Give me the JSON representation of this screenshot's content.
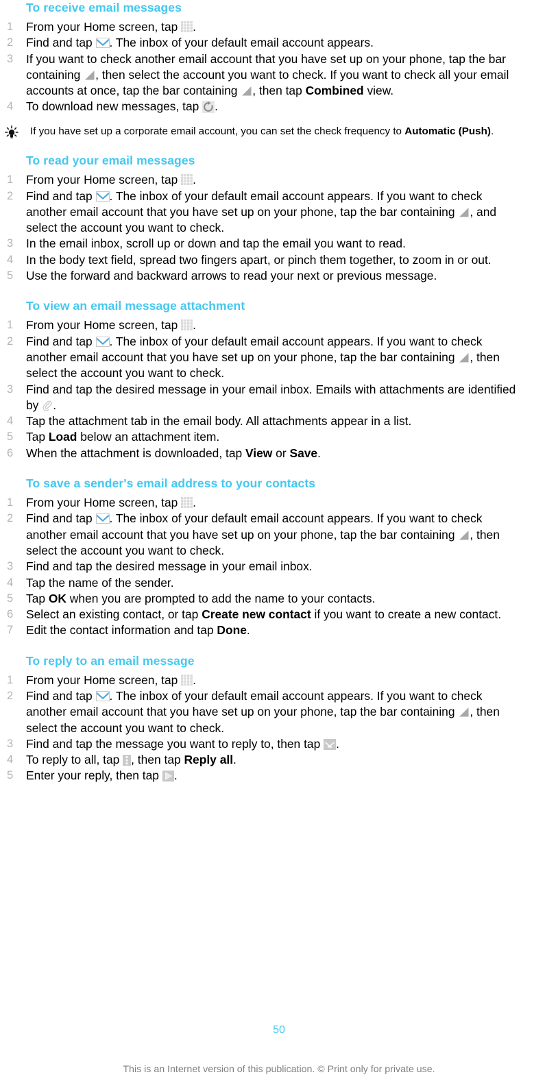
{
  "document": {
    "page_number": "50",
    "disclaimer": "This is an Internet version of this publication. © Print only for private use.",
    "accent_color": "#44c8f0",
    "text_color": "#000000",
    "number_color": "#b4b4b4",
    "footer_color": "#808080"
  },
  "sections": [
    {
      "heading": "To receive email messages",
      "steps": [
        {
          "number": "1",
          "parts": [
            {
              "t": "text",
              "v": "From your Home screen, tap "
            },
            {
              "t": "icon",
              "v": "grid-icon"
            },
            {
              "t": "text",
              "v": "."
            }
          ]
        },
        {
          "number": "2",
          "parts": [
            {
              "t": "text",
              "v": "Find and tap "
            },
            {
              "t": "icon",
              "v": "envelope-icon"
            },
            {
              "t": "text",
              "v": ". The inbox of your default email account appears."
            }
          ]
        },
        {
          "number": "3",
          "parts": [
            {
              "t": "text",
              "v": "If you want to check another email account that you have set up on your phone, tap the bar containing "
            },
            {
              "t": "icon",
              "v": "triangle-icon"
            },
            {
              "t": "text",
              "v": ", then select the account you want to check. If you want to check all your email accounts at once, tap the bar containing "
            },
            {
              "t": "icon",
              "v": "triangle-icon"
            },
            {
              "t": "text",
              "v": ", then tap "
            },
            {
              "t": "bold",
              "v": "Combined"
            },
            {
              "t": "text",
              "v": " view."
            }
          ]
        },
        {
          "number": "4",
          "parts": [
            {
              "t": "text",
              "v": "To download new messages, tap "
            },
            {
              "t": "icon",
              "v": "refresh-icon"
            },
            {
              "t": "text",
              "v": "."
            }
          ]
        }
      ],
      "tip": {
        "icon": "lightbulb-icon",
        "parts": [
          {
            "t": "text",
            "v": "If you have set up a corporate email account, you can set the check frequency to "
          },
          {
            "t": "bold",
            "v": "Automatic (Push)"
          },
          {
            "t": "text",
            "v": "."
          }
        ]
      }
    },
    {
      "heading": "To read your email messages",
      "steps": [
        {
          "number": "1",
          "parts": [
            {
              "t": "text",
              "v": "From your Home screen, tap "
            },
            {
              "t": "icon",
              "v": "grid-icon"
            },
            {
              "t": "text",
              "v": "."
            }
          ]
        },
        {
          "number": "2",
          "parts": [
            {
              "t": "text",
              "v": "Find and tap "
            },
            {
              "t": "icon",
              "v": "envelope-icon"
            },
            {
              "t": "text",
              "v": ". The inbox of your default email account appears. If you want to check another email account that you have set up on your phone, tap the bar containing "
            },
            {
              "t": "icon",
              "v": "triangle-icon"
            },
            {
              "t": "text",
              "v": ", and select the account you want to check."
            }
          ]
        },
        {
          "number": "3",
          "parts": [
            {
              "t": "text",
              "v": "In the email inbox, scroll up or down and tap the email you want to read."
            }
          ]
        },
        {
          "number": "4",
          "parts": [
            {
              "t": "text",
              "v": "In the body text field, spread two fingers apart, or pinch them together, to zoom in or out."
            }
          ]
        },
        {
          "number": "5",
          "parts": [
            {
              "t": "text",
              "v": "Use the forward and backward arrows to read your next or previous message."
            }
          ]
        }
      ]
    },
    {
      "heading": "To view an email message attachment",
      "steps": [
        {
          "number": "1",
          "parts": [
            {
              "t": "text",
              "v": "From your Home screen, tap "
            },
            {
              "t": "icon",
              "v": "grid-icon"
            },
            {
              "t": "text",
              "v": "."
            }
          ]
        },
        {
          "number": "2",
          "parts": [
            {
              "t": "text",
              "v": "Find and tap "
            },
            {
              "t": "icon",
              "v": "envelope-icon"
            },
            {
              "t": "text",
              "v": ". The inbox of your default email account appears. If you want to check another email account that you have set up on your phone, tap the bar containing "
            },
            {
              "t": "icon",
              "v": "triangle-icon"
            },
            {
              "t": "text",
              "v": ", then select the account you want to check."
            }
          ]
        },
        {
          "number": "3",
          "parts": [
            {
              "t": "text",
              "v": "Find and tap the desired message in your email inbox. Emails with attachments are identified by "
            },
            {
              "t": "icon",
              "v": "paperclip-icon"
            },
            {
              "t": "text",
              "v": "."
            }
          ]
        },
        {
          "number": "4",
          "parts": [
            {
              "t": "text",
              "v": "Tap the attachment tab in the email body. All attachments appear in a list."
            }
          ]
        },
        {
          "number": "5",
          "parts": [
            {
              "t": "text",
              "v": "Tap "
            },
            {
              "t": "bold",
              "v": "Load"
            },
            {
              "t": "text",
              "v": " below an attachment item."
            }
          ]
        },
        {
          "number": "6",
          "parts": [
            {
              "t": "text",
              "v": "When the attachment is downloaded, tap "
            },
            {
              "t": "bold",
              "v": "View"
            },
            {
              "t": "text",
              "v": " or "
            },
            {
              "t": "bold",
              "v": "Save"
            },
            {
              "t": "text",
              "v": "."
            }
          ]
        }
      ]
    },
    {
      "heading": "To save a sender's email address to your contacts",
      "steps": [
        {
          "number": "1",
          "parts": [
            {
              "t": "text",
              "v": "From your Home screen, tap "
            },
            {
              "t": "icon",
              "v": "grid-icon"
            },
            {
              "t": "text",
              "v": "."
            }
          ]
        },
        {
          "number": "2",
          "parts": [
            {
              "t": "text",
              "v": "Find and tap "
            },
            {
              "t": "icon",
              "v": "envelope-icon"
            },
            {
              "t": "text",
              "v": ". The inbox of your default email account appears. If you want to check another email account that you have set up on your phone, tap the bar containing "
            },
            {
              "t": "icon",
              "v": "triangle-icon"
            },
            {
              "t": "text",
              "v": ", then select the account you want to check."
            }
          ]
        },
        {
          "number": "3",
          "parts": [
            {
              "t": "text",
              "v": "Find and tap the desired message in your email inbox."
            }
          ]
        },
        {
          "number": "4",
          "parts": [
            {
              "t": "text",
              "v": "Tap the name of the sender."
            }
          ]
        },
        {
          "number": "5",
          "parts": [
            {
              "t": "text",
              "v": "Tap "
            },
            {
              "t": "bold",
              "v": "OK"
            },
            {
              "t": "text",
              "v": " when you are prompted to add the name to your contacts."
            }
          ]
        },
        {
          "number": "6",
          "parts": [
            {
              "t": "text",
              "v": "Select an existing contact, or tap "
            },
            {
              "t": "bold",
              "v": "Create new contact"
            },
            {
              "t": "text",
              "v": " if you want to create a new contact."
            }
          ]
        },
        {
          "number": "7",
          "parts": [
            {
              "t": "text",
              "v": "Edit the contact information and tap "
            },
            {
              "t": "bold",
              "v": "Done"
            },
            {
              "t": "text",
              "v": "."
            }
          ]
        }
      ]
    },
    {
      "heading": "To reply to an email message",
      "steps": [
        {
          "number": "1",
          "parts": [
            {
              "t": "text",
              "v": "From your Home screen, tap "
            },
            {
              "t": "icon",
              "v": "grid-icon"
            },
            {
              "t": "text",
              "v": "."
            }
          ]
        },
        {
          "number": "2",
          "parts": [
            {
              "t": "text",
              "v": "Find and tap "
            },
            {
              "t": "icon",
              "v": "envelope-icon"
            },
            {
              "t": "text",
              "v": ". The inbox of your default email account appears. If you want to check another email account that you have set up on your phone, tap the bar containing "
            },
            {
              "t": "icon",
              "v": "triangle-icon"
            },
            {
              "t": "text",
              "v": ", then select the account you want to check."
            }
          ]
        },
        {
          "number": "3",
          "parts": [
            {
              "t": "text",
              "v": "Find and tap the message you want to reply to, then tap "
            },
            {
              "t": "icon",
              "v": "reply-icon"
            },
            {
              "t": "text",
              "v": "."
            }
          ]
        },
        {
          "number": "4",
          "parts": [
            {
              "t": "text",
              "v": "To reply to all, tap "
            },
            {
              "t": "icon",
              "v": "kebab-icon"
            },
            {
              "t": "text",
              "v": ", then tap "
            },
            {
              "t": "bold",
              "v": "Reply all"
            },
            {
              "t": "text",
              "v": "."
            }
          ]
        },
        {
          "number": "5",
          "parts": [
            {
              "t": "text",
              "v": "Enter your reply, then tap "
            },
            {
              "t": "icon",
              "v": "send-icon"
            },
            {
              "t": "text",
              "v": "."
            }
          ]
        }
      ]
    }
  ]
}
